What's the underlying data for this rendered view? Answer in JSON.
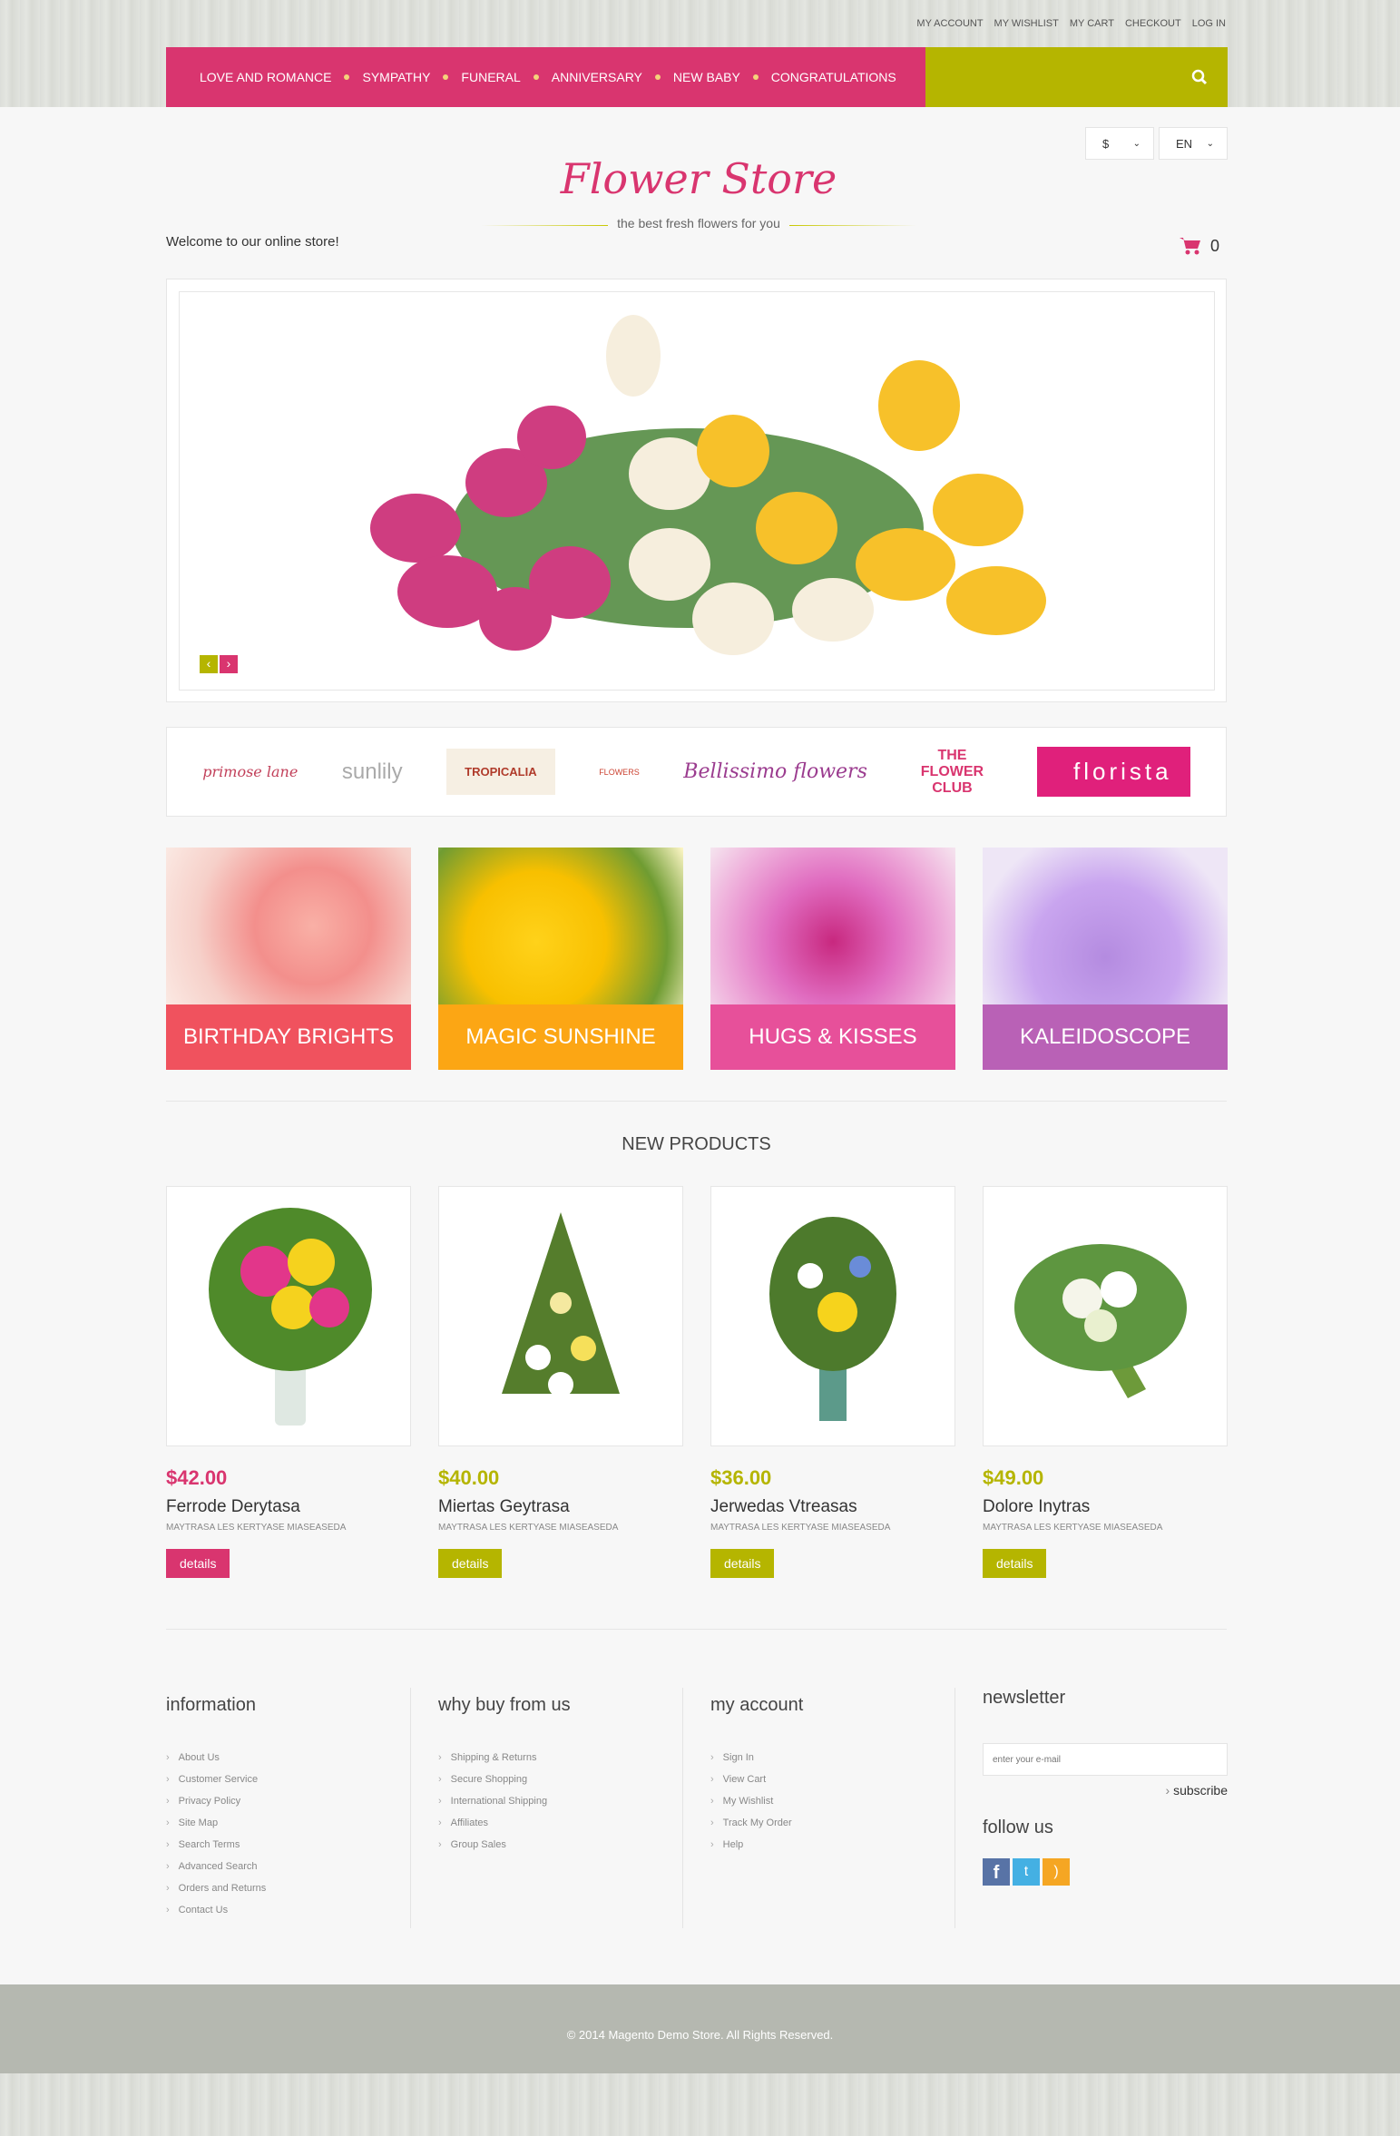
{
  "top_links": [
    "MY ACCOUNT",
    "MY WISHLIST",
    "MY CART",
    "CHECKOUT",
    "LOG IN"
  ],
  "nav": [
    "LOVE AND ROMANCE",
    "SYMPATHY",
    "FUNERAL",
    "ANNIVERSARY",
    "NEW BABY",
    "CONGRATULATIONS"
  ],
  "currency": "$",
  "language": "EN",
  "logo": "Flower Store",
  "tagline": "the best fresh flowers for you",
  "welcome": "Welcome to our online store!",
  "cart_count": "0",
  "slider": {
    "prev": "‹",
    "next": "›"
  },
  "brands": [
    "primose lane",
    "sunlily",
    "TROPICALIA",
    "FLOWERS",
    "Bellissimo flowers",
    "THE FLOWER CLUB",
    "florista"
  ],
  "categories": [
    {
      "label": "BIRTHDAY BRIGHTS",
      "color": "#f0525e"
    },
    {
      "label": "MAGIC SUNSHINE",
      "color": "#fca614"
    },
    {
      "label": "HUGS & KISSES",
      "color": "#e7509a"
    },
    {
      "label": "KALEIDOSCOPE",
      "color": "#b961b6"
    }
  ],
  "new_products_title": "NEW PRODUCTS",
  "products": [
    {
      "price": "$42.00",
      "name": "Ferrode Derytasa",
      "desc": "MAYTRASA LES KERTYASE MIASEASEDA",
      "button": "details",
      "accent": "#d9356f"
    },
    {
      "price": "$40.00",
      "name": "Miertas Geytrasa",
      "desc": "MAYTRASA LES KERTYASE MIASEASEDA",
      "button": "details",
      "accent": "#b5b500"
    },
    {
      "price": "$36.00",
      "name": "Jerwedas Vtreasas",
      "desc": "MAYTRASA LES KERTYASE MIASEASEDA",
      "button": "details",
      "accent": "#b5b500"
    },
    {
      "price": "$49.00",
      "name": "Dolore Inytras",
      "desc": "MAYTRASA LES KERTYASE MIASEASEDA",
      "button": "details",
      "accent": "#b5b500"
    }
  ],
  "footer": {
    "information": {
      "title": "information",
      "links": [
        "About Us",
        "Customer Service",
        "Privacy Policy",
        "Site Map",
        "Search Terms",
        "Advanced Search",
        "Orders and Returns",
        "Contact Us"
      ]
    },
    "why": {
      "title": "why buy from us",
      "links": [
        "Shipping & Returns",
        "Secure Shopping",
        "International Shipping",
        "Affiliates",
        "Group Sales"
      ]
    },
    "account": {
      "title": "my account",
      "links": [
        "Sign In",
        "View Cart",
        "My Wishlist",
        "Track My Order",
        "Help"
      ]
    },
    "newsletter": {
      "title": "newsletter",
      "placeholder": "enter your e-mail",
      "subscribe": "subscribe",
      "follow": "follow us"
    },
    "social": [
      "facebook",
      "twitter",
      "rss"
    ]
  },
  "copyright": "© 2014 Magento Demo Store. All Rights Reserved.",
  "colors": {
    "pink": "#d9356f",
    "olive": "#b5b500"
  }
}
